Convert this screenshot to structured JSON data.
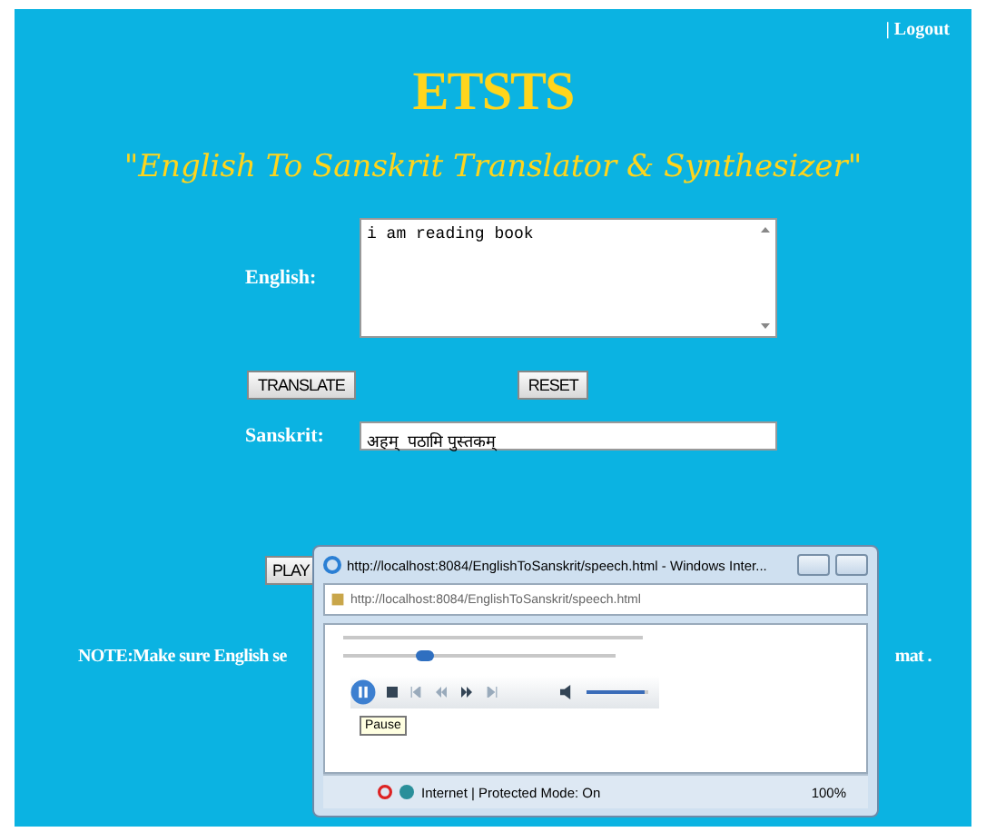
{
  "header": {
    "logout_link": "| Logout",
    "title": "ETSTS",
    "subtitle": "\"English To Sanskrit Translator & Synthesizer\""
  },
  "english": {
    "label": "English:",
    "value": "i am reading book"
  },
  "buttons": [
    {
      "label": "TRANSLATE"
    },
    {
      "label": "RESET"
    }
  ],
  "sanskrit": {
    "label": "Sanskrit:",
    "value": "अहम्  पठामि पुस्तकम्"
  },
  "play_button": {
    "label": "PLAY"
  },
  "note": {
    "start": "NOTE:Make sure English se",
    "end": "mat ."
  },
  "popup": {
    "title": "http://localhost:8084/EnglishToSanskrit/speech.html - Windows Inter...",
    "address": "http://localhost:8084/EnglishToSanskrit/speech.html",
    "player": {
      "seek": {
        "level": 0.3
      },
      "volume": {
        "level": 0.95
      },
      "tooltip": "Pause"
    },
    "status_bar": {
      "zone": "Internet | Protected Mode: On",
      "zoom": "100%"
    }
  }
}
